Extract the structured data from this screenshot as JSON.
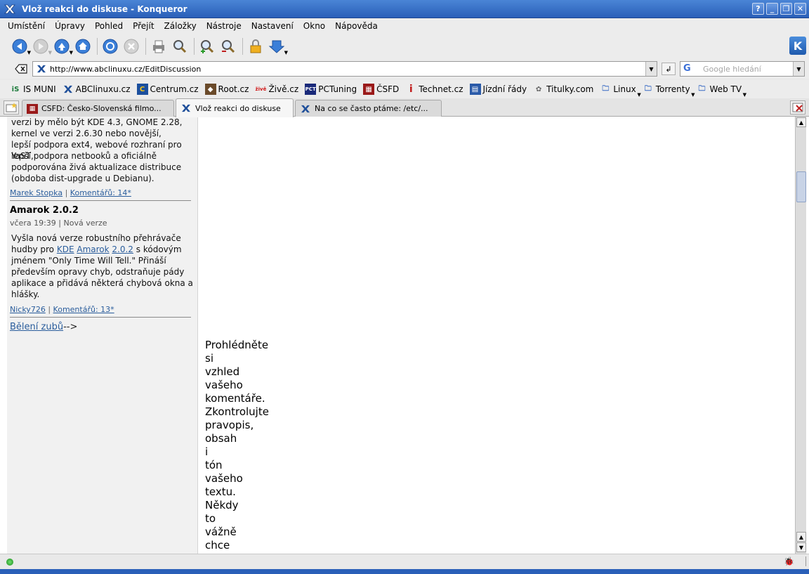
{
  "window": {
    "title": "Vlož reakci do diskuse - Konqueror",
    "buttons": [
      "?",
      "_",
      "❐",
      "✕"
    ]
  },
  "menubar": [
    {
      "label": "Umístění"
    },
    {
      "label": "Úpravy"
    },
    {
      "label": "Pohled"
    },
    {
      "label": "Přejít"
    },
    {
      "label": "Záložky"
    },
    {
      "label": "Nástroje"
    },
    {
      "label": "Nastavení"
    },
    {
      "label": "Okno"
    },
    {
      "label": "Nápověda"
    }
  ],
  "toolbar": {
    "icons": [
      "back-icon",
      "forward-icon",
      "up-icon",
      "home-icon",
      "reload-icon",
      "stop-icon",
      "print-icon",
      "find-icon",
      "zoom-in-icon",
      "zoom-out-icon",
      "lock-icon",
      "download-icon"
    ]
  },
  "location": {
    "url": "http://www.abclinuxu.cz/EditDiscussion",
    "search_placeholder": "Google hledání"
  },
  "bookmarks": [
    {
      "label": "IS MUNI",
      "icon": "is-muni-icon"
    },
    {
      "label": "ABClinuxu.cz",
      "icon": "abclinuxu-icon"
    },
    {
      "label": "Centrum.cz",
      "icon": "centrum-icon"
    },
    {
      "label": "Root.cz",
      "icon": "root-icon"
    },
    {
      "label": "Živě.cz",
      "icon": "zive-icon"
    },
    {
      "label": "PCTuning",
      "icon": "pctuning-icon"
    },
    {
      "label": "ČSFD",
      "icon": "csfd-icon"
    },
    {
      "label": "Technet.cz",
      "icon": "technet-icon"
    },
    {
      "label": "Jízdní řády",
      "icon": "timetable-icon"
    },
    {
      "label": "Titulky.com",
      "icon": "titulky-icon"
    },
    {
      "label": "Linux",
      "icon": "folder-icon"
    },
    {
      "label": "Torrenty",
      "icon": "folder-icon"
    },
    {
      "label": "Web TV",
      "icon": "folder-icon"
    }
  ],
  "tabs": [
    {
      "label": "CSFD: Česko-Slovenská filmo...",
      "active": false
    },
    {
      "label": "Vlož reakci do diskuse",
      "active": true
    },
    {
      "label": "Na co se často ptáme: /etc/...",
      "active": false
    }
  ],
  "sidebar": {
    "lines_top": [
      "verzi by mělo být KDE 4.3, GNOME 2.28,",
      "kernel ve verzi 2.6.30 nebo novější,",
      "lepší podpora ext4, webové rozhraní pro YaST,",
      "lepší podpora netbooků a oficiálně",
      "podporována živá aktualizace distribuce",
      "(obdoba dist-upgrade u Debianu)."
    ],
    "item1_author": "Marek Stopka",
    "item1_sep": "|",
    "item1_comments": "Komentářů: 14*",
    "item2_title": "Amarok 2.0.2",
    "item2_meta": "včera 19:39 | Nová verze",
    "item2_l1_pre": "Vyšla nová verze robustního přehrávače",
    "item2_l2_pre": "hudby pro",
    "item2_l2_kde": "KDE",
    "item2_l2_amarok": "Amarok",
    "item2_l2_ver": "2.0.2",
    "item2_l2_post": "s kódovým",
    "item2_l3": "jménem \"Only Time Will Tell.\" Přináší",
    "item2_l4": "především opravy chyb, odstraňuje pády",
    "item2_l5": "aplikace a přidává některá chybová okna a",
    "item2_l6": "hlášky.",
    "item2_author": "Nicky726",
    "item2_sep": "|",
    "item2_comments": "Komentářů: 13*",
    "ad_link": "Bělení zubů",
    "ad_suffix": "-->"
  },
  "main_words": [
    "Prohlédněte",
    "si",
    "vzhled",
    "vašeho",
    "komentáře.",
    "Zkontrolujte",
    "pravopis,",
    "obsah",
    "i",
    "tón",
    "vašeho",
    "textu.",
    "Někdy",
    "to",
    "vážně",
    "chce"
  ]
}
